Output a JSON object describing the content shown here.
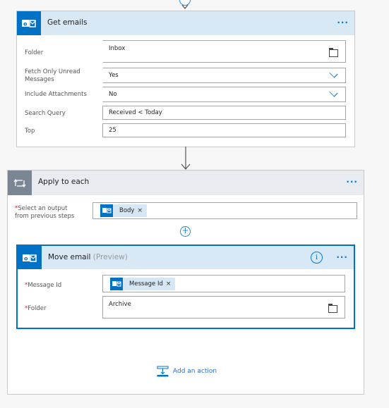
{
  "get_emails": {
    "title": "Get emails",
    "more_icon": "ellipsis-icon",
    "fields": [
      {
        "label": "Folder",
        "value": "Inbox",
        "control": "folder-picker"
      },
      {
        "label": "Fetch Only Unread Messages",
        "value": "Yes",
        "control": "dropdown"
      },
      {
        "label": "Include Attachments",
        "value": "No",
        "control": "dropdown"
      },
      {
        "label": "Search Query",
        "value": "Received < Today",
        "control": "text"
      },
      {
        "label": "Top",
        "value": "25",
        "control": "text"
      }
    ],
    "dots": "···"
  },
  "apply_to_each": {
    "title": "Apply to each",
    "dots": "···",
    "select_label_req": "*",
    "select_label": "Select an output from previous steps",
    "select_label_line1": "Select an output",
    "select_label_line2": "from previous steps",
    "token": {
      "label": "Body",
      "remove": "×"
    }
  },
  "insert_step": {
    "symbol": "+"
  },
  "move_email": {
    "title": "Move email",
    "subtitle": "(Preview)",
    "info_symbol": "i",
    "dots": "···",
    "req": "*",
    "message_id_label": "Message Id",
    "message_id_token": {
      "label": "Message Id",
      "remove": "×"
    },
    "folder_label": "Folder",
    "folder_value": "Archive"
  },
  "add_action": {
    "label": "Add an action"
  },
  "colors": {
    "brand_blue": "#0072c6",
    "header_blue": "#d9e8f5",
    "loop_header": "#e8ebef",
    "loop_icon": "#7a8694",
    "required_red": "#c4262e",
    "link_blue": "#2b6fcc"
  }
}
